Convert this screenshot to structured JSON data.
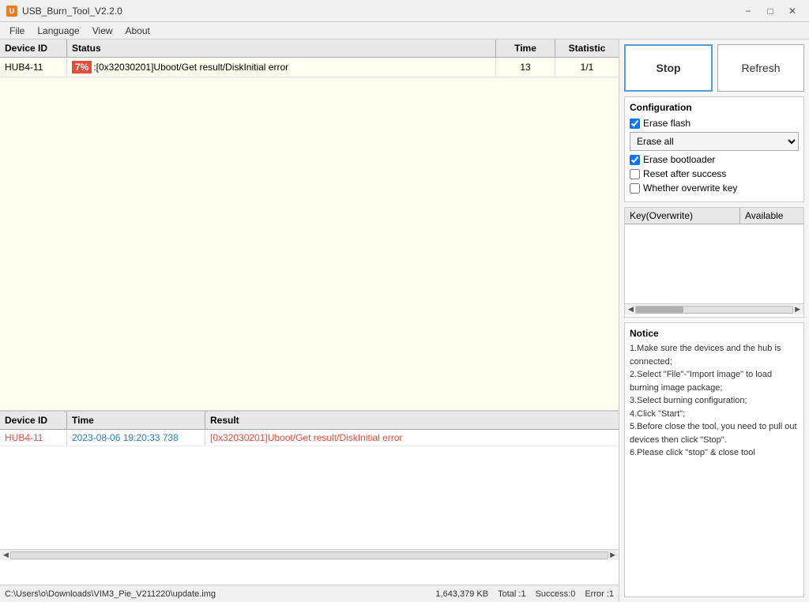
{
  "titlebar": {
    "title": "USB_Burn_Tool_V2.2.0",
    "icon": "U"
  },
  "menu": {
    "items": [
      "File",
      "Language",
      "View",
      "About"
    ]
  },
  "device_table": {
    "headers": {
      "device_id": "Device ID",
      "status": "Status",
      "time": "Time",
      "statistic": "Statistic"
    },
    "rows": [
      {
        "device_id": "HUB4-11",
        "status_percent": "7%",
        "status_text": ":[0x32030201]Uboot/Get result/DiskInitial error",
        "time": "13",
        "statistic": "1/1"
      }
    ]
  },
  "log_table": {
    "headers": {
      "device_id": "Device ID",
      "time": "Time",
      "result": "Result"
    },
    "rows": [
      {
        "device_id": "HUB4-11",
        "time": "2023-08-06 19:20:33 738",
        "result": "[0x32030201]Uboot/Get result/DiskInitial error"
      }
    ]
  },
  "buttons": {
    "stop": "Stop",
    "refresh": "Refresh"
  },
  "configuration": {
    "title": "Configuration",
    "erase_flash": {
      "label": "Erase flash",
      "checked": true
    },
    "erase_all_options": [
      "Erase all"
    ],
    "erase_all_selected": "Erase all",
    "erase_bootloader": {
      "label": "Erase bootloader",
      "checked": true
    },
    "reset_after_success": {
      "label": "Reset after success",
      "checked": false
    },
    "whether_overwrite_key": {
      "label": "Whether overwrite key",
      "checked": false
    }
  },
  "key_table": {
    "headers": {
      "key": "Key(Overwrite)",
      "available": "Available"
    }
  },
  "notice": {
    "title": "Notice",
    "lines": [
      "1.Make sure the devices and the hub is connected;",
      "2.Select \"File\"-\"Import image\" to load burning image package;",
      "3.Select burning configuration;",
      "4.Click \"Start\";",
      "5.Before close the tool, you need to pull out devices then click \"Stop\".",
      "6.Please click \"stop\" & close tool"
    ]
  },
  "statusbar": {
    "filepath": "C:\\Users\\o\\Downloads\\VIM3_Pie_V211220\\update.img",
    "size": "1,643,379 KB",
    "total": "Total :1",
    "success": "Success:0",
    "error": "Error :1"
  }
}
